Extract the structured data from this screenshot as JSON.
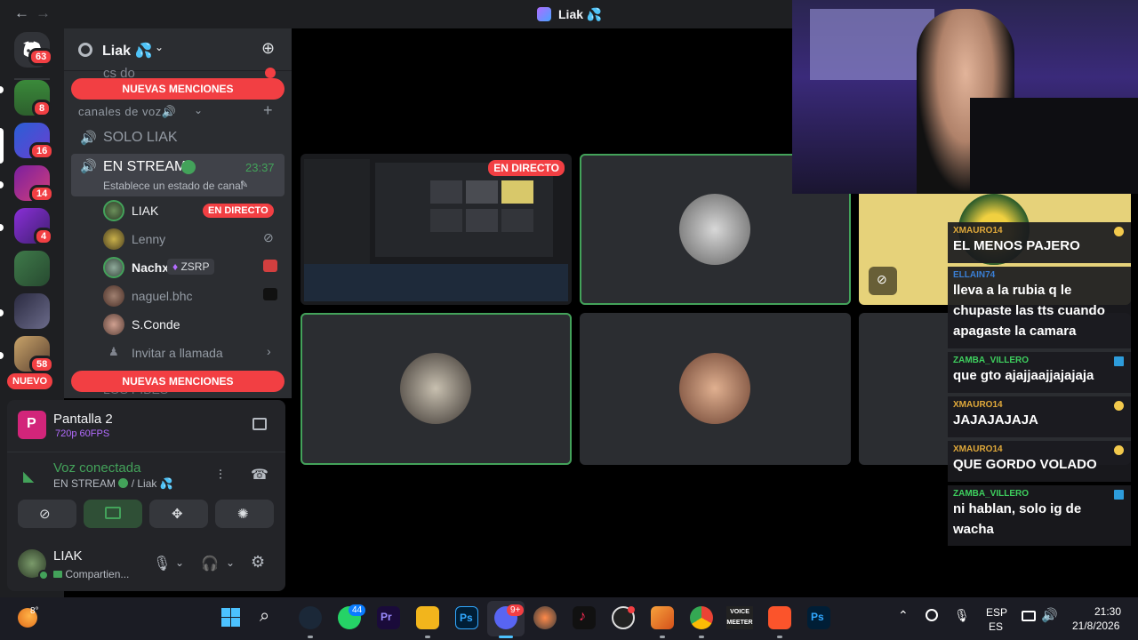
{
  "titlebar": {
    "back": "←",
    "forward": "→",
    "title": "Liak 💦"
  },
  "rail": {
    "home_badge": "63",
    "servers": [
      {
        "badge": "8"
      },
      {
        "badge": "16"
      },
      {
        "badge": "14"
      },
      {
        "badge": "4"
      },
      {
        "badge": ""
      },
      {
        "badge": ""
      },
      {
        "badge": "58"
      }
    ],
    "new_label": "NUEVO"
  },
  "channels": {
    "server_name": "Liak 💦",
    "partial_top": "cs do",
    "mentions_label": "NUEVAS MENCIONES",
    "category": "canales de voz🔊",
    "solo_channel": "SOLO LIAK",
    "stream_channel": "EN STREAM",
    "stream_timer": "23:37",
    "stream_status": "Establece un estado de canal",
    "users": [
      {
        "name": "LIAK",
        "tag": "EN DIRECTO"
      },
      {
        "name": "Lenny",
        "tag": ""
      },
      {
        "name": "Nachx",
        "tag": "ZSRP"
      },
      {
        "name": "naguel.bhc",
        "tag": ""
      },
      {
        "name": "S.Conde",
        "tag": ""
      }
    ],
    "invite": "Invitar a llamada",
    "partial_bottom": "LOS PIBES"
  },
  "screenshare": {
    "title": "Pantalla 2",
    "quality": "720p 60FPS"
  },
  "voice": {
    "status": "Voz conectada",
    "location": "EN STREAM",
    "server": "/ Liak 💦"
  },
  "user": {
    "name": "LIAK",
    "status": "Compartien..."
  },
  "stage": {
    "live_label": "EN DIRECTO"
  },
  "chat": [
    {
      "user": "XMAURO14",
      "text": "EL MENOS PAJERO",
      "color": "#e0a93a",
      "icon": "#f2c94c"
    },
    {
      "user": "ELLAIN74",
      "text": "lleva a la rubia q le chupaste las tts cuando apagaste la camara",
      "color": "#3a7fd5",
      "icon": ""
    },
    {
      "user": "ZAMBA_VILLERO",
      "text": "que gto ajajjaajjajajaja",
      "color": "#3ecf5e",
      "icon": "#2d9cdb"
    },
    {
      "user": "XMAURO14",
      "text": "JAJAJAJAJA",
      "color": "#e0a93a",
      "icon": "#f2c94c"
    },
    {
      "user": "XMAURO14",
      "text": "QUE GORDO VOLADO",
      "color": "#e0a93a",
      "icon": "#f2c94c"
    },
    {
      "user": "ZAMBA_VILLERO",
      "text": "ni hablan, solo ig de wacha",
      "color": "#3ecf5e",
      "icon": "#2d9cdb"
    }
  ],
  "taskbar": {
    "weather": "8°",
    "whatsapp_badge": "44",
    "discord_badge": "9+",
    "voicemeeter": "VOICE MEETER",
    "lang": "ESP",
    "region": "ES",
    "time": "21:30",
    "date": "21/8/2026"
  },
  "colors": {
    "accent_green": "#43a25a",
    "danger": "#f23f43",
    "discord": "#5865f2"
  }
}
